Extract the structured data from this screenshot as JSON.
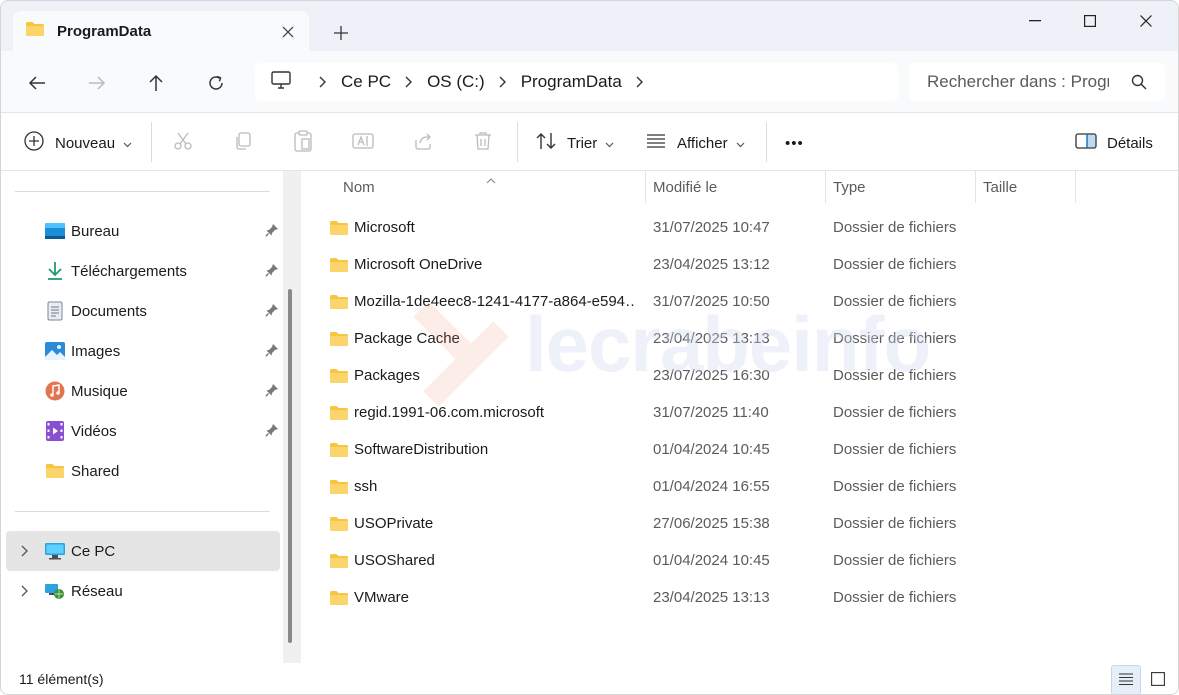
{
  "tab": {
    "title": "ProgramData"
  },
  "address": {
    "crumbs": [
      "Ce PC",
      "OS (C:)",
      "ProgramData"
    ]
  },
  "search": {
    "placeholder": "Rechercher dans : Progr"
  },
  "toolbar": {
    "new_label": "Nouveau",
    "sort_label": "Trier",
    "view_label": "Afficher",
    "more_label": "•••",
    "details_label": "Détails"
  },
  "sidebar": {
    "items": [
      {
        "label": "Bureau",
        "icon": "desktop-icon"
      },
      {
        "label": "Téléchargements",
        "icon": "download-icon"
      },
      {
        "label": "Documents",
        "icon": "documents-icon"
      },
      {
        "label": "Images",
        "icon": "images-icon"
      },
      {
        "label": "Musique",
        "icon": "music-icon"
      },
      {
        "label": "Vidéos",
        "icon": "videos-icon"
      },
      {
        "label": "Shared",
        "icon": "folder-icon"
      }
    ],
    "this_pc": "Ce PC",
    "network": "Réseau"
  },
  "columns": {
    "name": "Nom",
    "modified": "Modifié le",
    "type": "Type",
    "size": "Taille"
  },
  "files": [
    {
      "name": "Microsoft",
      "date": "31/07/2025 10:47",
      "type": "Dossier de fichiers"
    },
    {
      "name": "Microsoft OneDrive",
      "date": "23/04/2025 13:12",
      "type": "Dossier de fichiers"
    },
    {
      "name": "Mozilla-1de4eec8-1241-4177-a864-e594…",
      "date": "31/07/2025 10:50",
      "type": "Dossier de fichiers"
    },
    {
      "name": "Package Cache",
      "date": "23/04/2025 13:13",
      "type": "Dossier de fichiers"
    },
    {
      "name": "Packages",
      "date": "23/07/2025 16:30",
      "type": "Dossier de fichiers"
    },
    {
      "name": "regid.1991-06.com.microsoft",
      "date": "31/07/2025 11:40",
      "type": "Dossier de fichiers"
    },
    {
      "name": "SoftwareDistribution",
      "date": "01/04/2024 10:45",
      "type": "Dossier de fichiers"
    },
    {
      "name": "ssh",
      "date": "01/04/2024 16:55",
      "type": "Dossier de fichiers"
    },
    {
      "name": "USOPrivate",
      "date": "27/06/2025 15:38",
      "type": "Dossier de fichiers"
    },
    {
      "name": "USOShared",
      "date": "01/04/2024 10:45",
      "type": "Dossier de fichiers"
    },
    {
      "name": "VMware",
      "date": "23/04/2025 13:13",
      "type": "Dossier de fichiers"
    }
  ],
  "status": {
    "count": "11 élément(s)"
  },
  "watermark": "lecrabeinfo",
  "colors": {
    "folder": "#f8c541",
    "accent": "#0067c0"
  }
}
